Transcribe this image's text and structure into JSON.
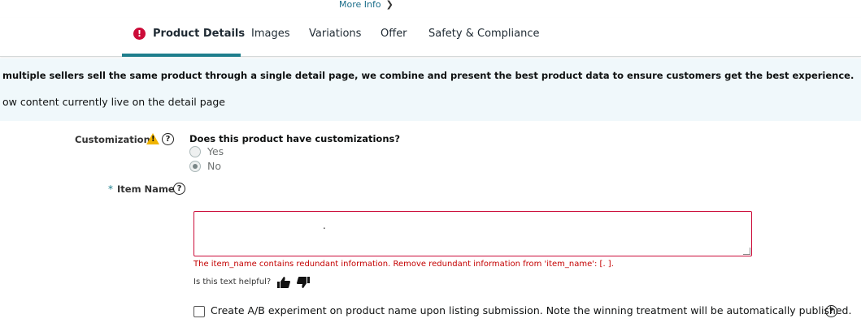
{
  "header": {
    "more_info": "More Info",
    "tabs": [
      {
        "label": "Product Details",
        "active": true,
        "has_error": true
      },
      {
        "label": "Images"
      },
      {
        "label": "Variations"
      },
      {
        "label": "Offer"
      },
      {
        "label": "Safety & Compliance"
      }
    ],
    "accent_color": "#1e7e8c",
    "error_color": "#cc0c39"
  },
  "banner": {
    "line1": "multiple sellers sell the same product through a single detail page, we combine and present the best product data to ensure customers get the best experience.",
    "line2": "ow content currently live on the detail page",
    "background": "#f0f8fb"
  },
  "form": {
    "customizations": {
      "label": "Customizations",
      "question": "Does this product have customizations?",
      "options": [
        {
          "label": "Yes",
          "checked": false
        },
        {
          "label": "No",
          "checked": true
        }
      ]
    },
    "item_name": {
      "required_marker": "*",
      "label": "Item Name",
      "value": ".",
      "error": "The item_name contains redundant information. Remove redundant information from 'item_name': [.          ].",
      "helpful_prompt": "Is this text helpful?"
    },
    "ab_experiment": {
      "checked": false,
      "label": "Create A/B experiment on product name upon listing submission. Note the winning treatment will be automatically published."
    }
  }
}
